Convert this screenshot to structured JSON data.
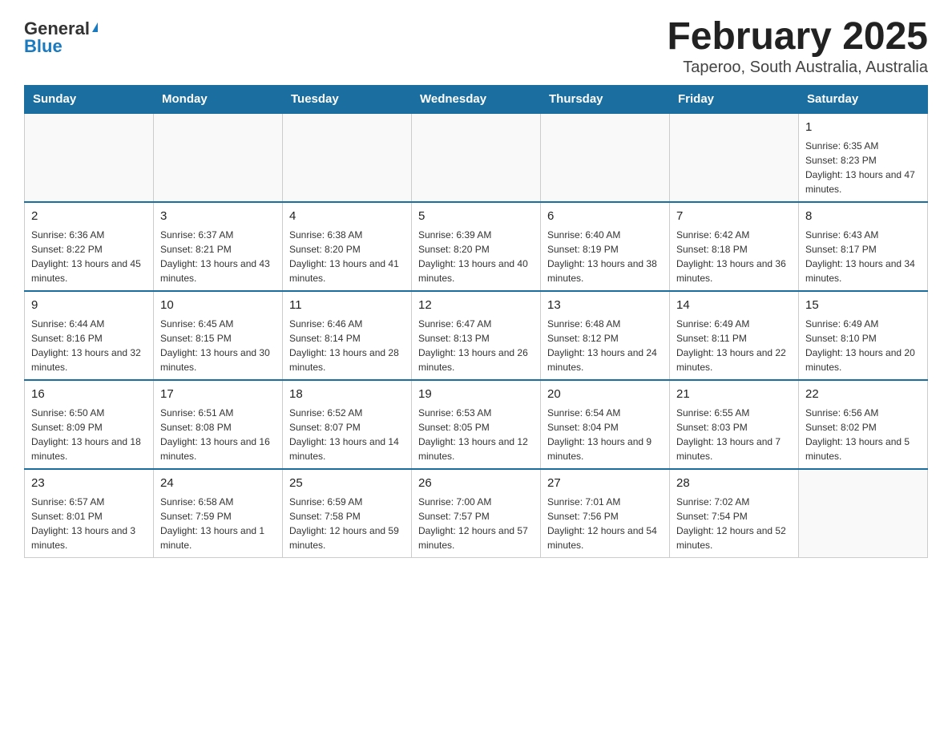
{
  "header": {
    "logo": {
      "general": "General",
      "blue": "Blue",
      "triangle": "▶"
    },
    "title": "February 2025",
    "subtitle": "Taperoo, South Australia, Australia"
  },
  "days_of_week": [
    "Sunday",
    "Monday",
    "Tuesday",
    "Wednesday",
    "Thursday",
    "Friday",
    "Saturday"
  ],
  "weeks": [
    [
      {
        "day": "",
        "info": ""
      },
      {
        "day": "",
        "info": ""
      },
      {
        "day": "",
        "info": ""
      },
      {
        "day": "",
        "info": ""
      },
      {
        "day": "",
        "info": ""
      },
      {
        "day": "",
        "info": ""
      },
      {
        "day": "1",
        "info": "Sunrise: 6:35 AM\nSunset: 8:23 PM\nDaylight: 13 hours and 47 minutes."
      }
    ],
    [
      {
        "day": "2",
        "info": "Sunrise: 6:36 AM\nSunset: 8:22 PM\nDaylight: 13 hours and 45 minutes."
      },
      {
        "day": "3",
        "info": "Sunrise: 6:37 AM\nSunset: 8:21 PM\nDaylight: 13 hours and 43 minutes."
      },
      {
        "day": "4",
        "info": "Sunrise: 6:38 AM\nSunset: 8:20 PM\nDaylight: 13 hours and 41 minutes."
      },
      {
        "day": "5",
        "info": "Sunrise: 6:39 AM\nSunset: 8:20 PM\nDaylight: 13 hours and 40 minutes."
      },
      {
        "day": "6",
        "info": "Sunrise: 6:40 AM\nSunset: 8:19 PM\nDaylight: 13 hours and 38 minutes."
      },
      {
        "day": "7",
        "info": "Sunrise: 6:42 AM\nSunset: 8:18 PM\nDaylight: 13 hours and 36 minutes."
      },
      {
        "day": "8",
        "info": "Sunrise: 6:43 AM\nSunset: 8:17 PM\nDaylight: 13 hours and 34 minutes."
      }
    ],
    [
      {
        "day": "9",
        "info": "Sunrise: 6:44 AM\nSunset: 8:16 PM\nDaylight: 13 hours and 32 minutes."
      },
      {
        "day": "10",
        "info": "Sunrise: 6:45 AM\nSunset: 8:15 PM\nDaylight: 13 hours and 30 minutes."
      },
      {
        "day": "11",
        "info": "Sunrise: 6:46 AM\nSunset: 8:14 PM\nDaylight: 13 hours and 28 minutes."
      },
      {
        "day": "12",
        "info": "Sunrise: 6:47 AM\nSunset: 8:13 PM\nDaylight: 13 hours and 26 minutes."
      },
      {
        "day": "13",
        "info": "Sunrise: 6:48 AM\nSunset: 8:12 PM\nDaylight: 13 hours and 24 minutes."
      },
      {
        "day": "14",
        "info": "Sunrise: 6:49 AM\nSunset: 8:11 PM\nDaylight: 13 hours and 22 minutes."
      },
      {
        "day": "15",
        "info": "Sunrise: 6:49 AM\nSunset: 8:10 PM\nDaylight: 13 hours and 20 minutes."
      }
    ],
    [
      {
        "day": "16",
        "info": "Sunrise: 6:50 AM\nSunset: 8:09 PM\nDaylight: 13 hours and 18 minutes."
      },
      {
        "day": "17",
        "info": "Sunrise: 6:51 AM\nSunset: 8:08 PM\nDaylight: 13 hours and 16 minutes."
      },
      {
        "day": "18",
        "info": "Sunrise: 6:52 AM\nSunset: 8:07 PM\nDaylight: 13 hours and 14 minutes."
      },
      {
        "day": "19",
        "info": "Sunrise: 6:53 AM\nSunset: 8:05 PM\nDaylight: 13 hours and 12 minutes."
      },
      {
        "day": "20",
        "info": "Sunrise: 6:54 AM\nSunset: 8:04 PM\nDaylight: 13 hours and 9 minutes."
      },
      {
        "day": "21",
        "info": "Sunrise: 6:55 AM\nSunset: 8:03 PM\nDaylight: 13 hours and 7 minutes."
      },
      {
        "day": "22",
        "info": "Sunrise: 6:56 AM\nSunset: 8:02 PM\nDaylight: 13 hours and 5 minutes."
      }
    ],
    [
      {
        "day": "23",
        "info": "Sunrise: 6:57 AM\nSunset: 8:01 PM\nDaylight: 13 hours and 3 minutes."
      },
      {
        "day": "24",
        "info": "Sunrise: 6:58 AM\nSunset: 7:59 PM\nDaylight: 13 hours and 1 minute."
      },
      {
        "day": "25",
        "info": "Sunrise: 6:59 AM\nSunset: 7:58 PM\nDaylight: 12 hours and 59 minutes."
      },
      {
        "day": "26",
        "info": "Sunrise: 7:00 AM\nSunset: 7:57 PM\nDaylight: 12 hours and 57 minutes."
      },
      {
        "day": "27",
        "info": "Sunrise: 7:01 AM\nSunset: 7:56 PM\nDaylight: 12 hours and 54 minutes."
      },
      {
        "day": "28",
        "info": "Sunrise: 7:02 AM\nSunset: 7:54 PM\nDaylight: 12 hours and 52 minutes."
      },
      {
        "day": "",
        "info": ""
      }
    ]
  ]
}
